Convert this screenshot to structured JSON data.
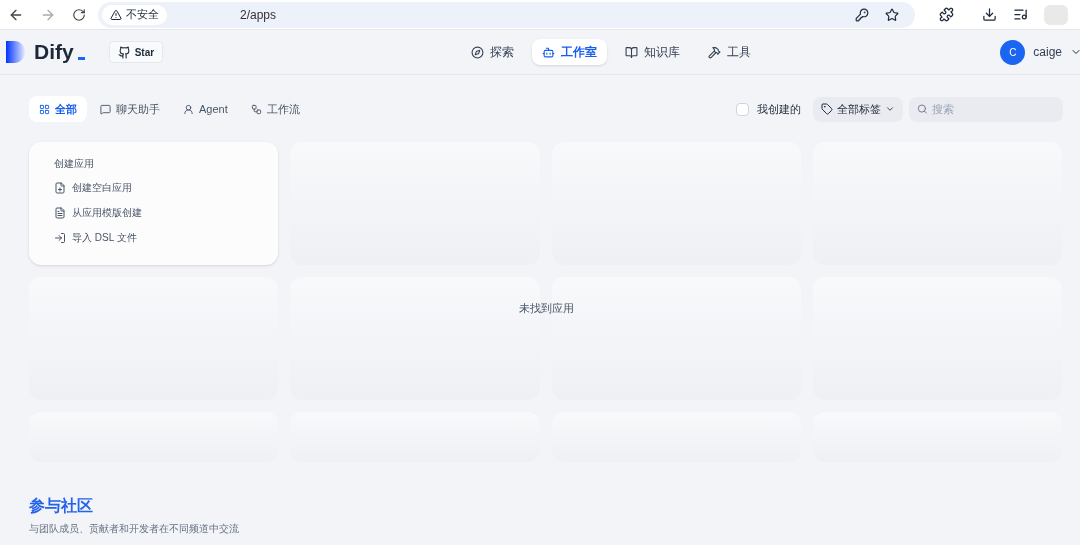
{
  "browser": {
    "security": "不安全",
    "url": "2/apps"
  },
  "header": {
    "logo": "Dify",
    "github": {
      "label": "Star"
    },
    "nav": [
      {
        "label": "探索",
        "selected": false
      },
      {
        "label": "工作室",
        "selected": true
      },
      {
        "label": "知识库",
        "selected": false
      },
      {
        "label": "工具",
        "selected": false
      }
    ],
    "user": {
      "initial": "C",
      "name": "caige"
    }
  },
  "filters": {
    "tabs": [
      {
        "label": "全部",
        "selected": true
      },
      {
        "label": "聊天助手",
        "selected": false
      },
      {
        "label": "Agent",
        "selected": false
      },
      {
        "label": "工作流",
        "selected": false
      }
    ],
    "mine": {
      "label": "我创建的",
      "checked": false
    },
    "tags": "全部标签",
    "search": {
      "placeholder": "搜索"
    }
  },
  "create_card": {
    "title": "创建应用",
    "actions": [
      {
        "label": "创建空白应用"
      },
      {
        "label": "从应用模版创建"
      },
      {
        "label": "导入 DSL 文件"
      }
    ]
  },
  "empty_message": "未找到应用",
  "community": {
    "title": "参与社区",
    "subtitle": "与团队成员、贡献者和开发者在不同频道中交流"
  }
}
